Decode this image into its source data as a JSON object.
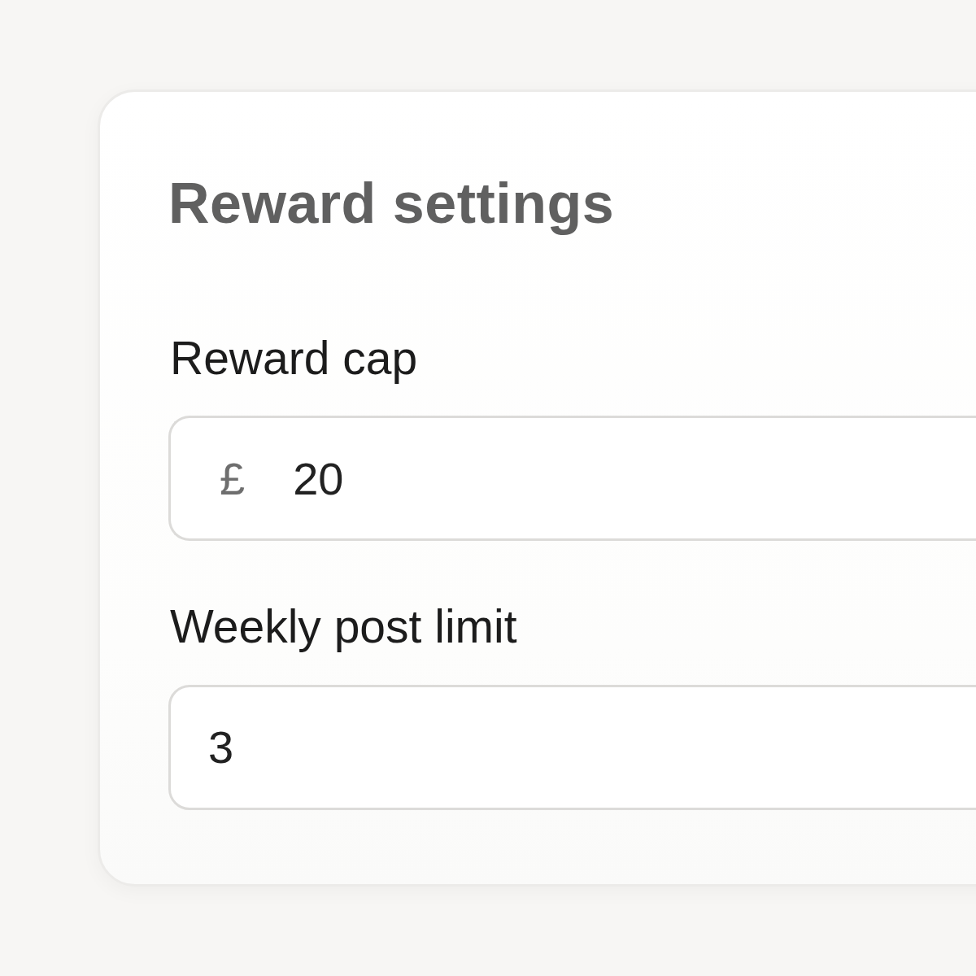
{
  "card": {
    "title": "Reward settings",
    "fields": [
      {
        "label": "Reward cap",
        "prefix": "£",
        "value": "20"
      },
      {
        "label": "Weekly post limit",
        "value": "3"
      }
    ]
  }
}
